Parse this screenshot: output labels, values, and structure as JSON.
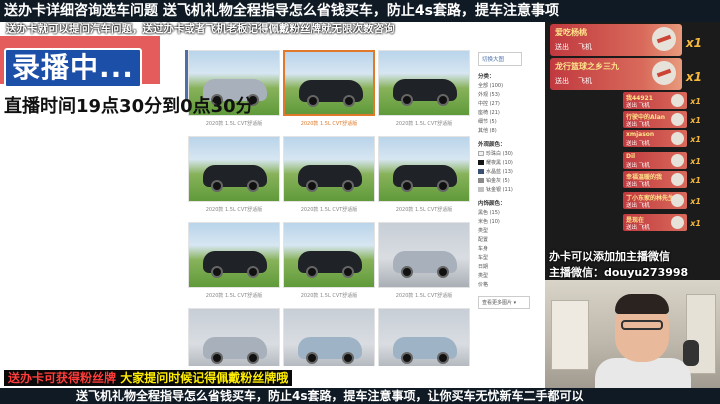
{
  "top_banner": "送办卡详细咨询选车问题  送飞机礼物全程指导怎么省钱买车，防止4s套路，提车注意事项",
  "ticker": "送办卡就可以提问汽车问题，送过办卡或者飞机老板记得佩戴粉丝牌就无限次数咨询",
  "overlay": {
    "recording": "录播中...",
    "live_time": "直播时间19点30分到0点30分"
  },
  "gallery": {
    "captions": [
      "2020款 1.5L CVT舒适版",
      "2020款 1.5L CVT舒适版",
      "2020款 1.5L CVT舒适版",
      "2020款 1.5L CVT舒适版",
      "2020款 1.5L CVT舒适版",
      "2020款 1.5L CVT舒适版",
      "2020款 1.5L CVT舒适版",
      "2020款 1.5L CVT舒适版",
      "2020款 1.5L CVT舒适版"
    ]
  },
  "filter": {
    "title": "切换大图",
    "category_head": "分类：",
    "categories": [
      "全部 (100)",
      "外观 (53)",
      "中控 (27)",
      "座椅 (21)",
      "细节 (5)",
      "其他 (8)"
    ],
    "exterior_head": "外观颜色：",
    "colors": [
      {
        "label": "珍珠白 (30)",
        "hex": "#f2f2f2"
      },
      {
        "label": "耀夜黑 (10)",
        "hex": "#151515"
      },
      {
        "label": "水晶蓝 (13)",
        "hex": "#3a4f73"
      },
      {
        "label": "铂金灰 (5)",
        "hex": "#8a8a8a"
      },
      {
        "label": "钛金银 (11)",
        "hex": "#c2c2c2"
      }
    ],
    "interior_head": "内饰颜色：",
    "interior": [
      "黑色 (15)",
      "米色 (10)"
    ],
    "more": "查看更多图片 ▾",
    "tags": [
      "类型",
      "配置",
      "车身",
      "车型",
      "日期",
      "类型",
      "价格"
    ]
  },
  "gifts": [
    {
      "name": "爱吃杨桃",
      "send": "送出",
      "item": "飞机",
      "count": "x1"
    },
    {
      "name": "龙行篮球之乡三九",
      "send": "送出",
      "item": "飞机",
      "count": "x1"
    }
  ],
  "chips": [
    {
      "name": "我44921",
      "item": "送出 飞机",
      "count": "x1"
    },
    {
      "name": "行驶中的Alan",
      "item": "送出 飞机",
      "count": "x1"
    },
    {
      "name": "xmjason",
      "item": "送出 飞机",
      "count": "x1"
    },
    {
      "name": "Dil",
      "item": "送出 飞机",
      "count": "x1"
    },
    {
      "name": "幸福温暖的我",
      "item": "送出 飞机",
      "count": "x1"
    },
    {
      "name": "丁小东家的林先生",
      "item": "送出 飞机",
      "count": "x1"
    },
    {
      "name": "是现在",
      "item": "送出 飞机",
      "count": "x1"
    }
  ],
  "info": {
    "line1": "办卡可以添加加主播微信",
    "line2": "主播微信：douyu273998"
  },
  "bottom_red": {
    "part1": "送办卡可获得粉丝牌",
    "part2": "大家提问时候记得佩戴粉丝牌哦"
  },
  "bottom_banner": "送飞机礼物全程指导怎么省钱买车，防止4s套路，提车注意事项，让你买车无忧新车二手都可以"
}
